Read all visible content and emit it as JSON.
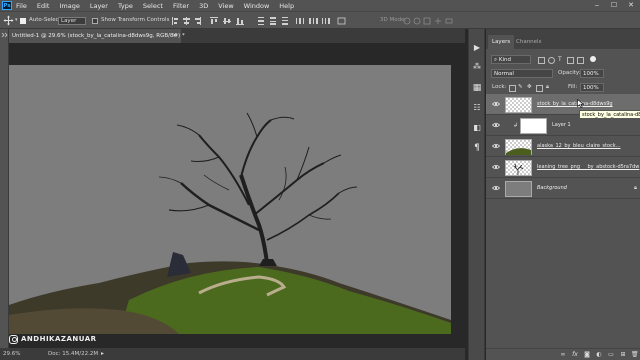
{
  "app": {
    "logo": "Ps"
  },
  "menu": [
    "File",
    "Edit",
    "Image",
    "Layer",
    "Type",
    "Select",
    "Filter",
    "3D",
    "View",
    "Window",
    "Help"
  ],
  "window_controls": {
    "minimize": "‒",
    "maximize": "☐",
    "close": "✕"
  },
  "options_bar": {
    "auto_select_label": "Auto-Select:",
    "auto_select_value": "Layer",
    "show_transform_label": "Show Transform Controls",
    "mode_3d_label": "3D Mode:"
  },
  "document_tab": {
    "title": "Untitled-1 @ 29.6% (stock_by_la_catalina-d8dws9g, RGB/8#) *",
    "close": "×"
  },
  "status": {
    "zoom": "29.6%",
    "doc": "Doc: 15.4M/22.2M"
  },
  "watermark": "ANDHIKAZANUAR",
  "layers_panel": {
    "tabs": [
      "Layers",
      "Channels"
    ],
    "filter_kind": "Kind",
    "blend_mode": "Normal",
    "opacity_label": "Opacity:",
    "opacity_value": "100%",
    "lock_label": "Lock:",
    "fill_label": "Fill:",
    "fill_value": "100%",
    "layers": [
      {
        "name": "stock_by_la_catalina-d8dws9g",
        "selected": true
      },
      {
        "name": "Layer 1",
        "selected": false
      },
      {
        "name": "alaska_12_by_bleu_claire_stock...",
        "selected": false
      },
      {
        "name": "leaning_tree_png___by_abstock-d5ra7dw",
        "selected": false
      },
      {
        "name": "Background",
        "selected": false
      }
    ],
    "tooltip": "stock_by_la_catalina-d8dws9g"
  },
  "colors": {
    "canvas_bg": "#7d7d7d",
    "panel_bg": "#535353",
    "selected_row": "#6d6d6d"
  }
}
